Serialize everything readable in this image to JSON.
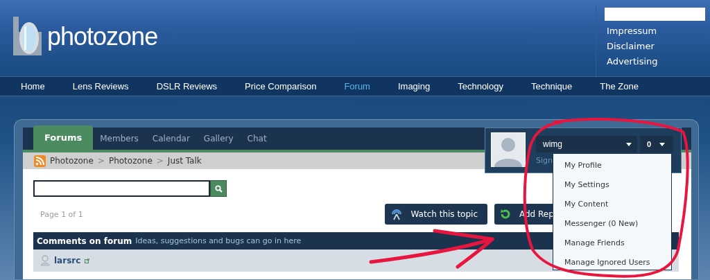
{
  "site": {
    "logo": "photozone",
    "links": [
      "Impressum",
      "Disclaimer",
      "Advertising"
    ]
  },
  "nav": [
    {
      "label": "Home",
      "selected": false
    },
    {
      "label": "Lens Reviews",
      "selected": false
    },
    {
      "label": "DSLR Reviews",
      "selected": false
    },
    {
      "label": "Price Comparison",
      "selected": false
    },
    {
      "label": "Forum",
      "selected": true
    },
    {
      "label": "Imaging",
      "selected": false
    },
    {
      "label": "Technology",
      "selected": false
    },
    {
      "label": "Technique",
      "selected": false
    },
    {
      "label": "The Zone",
      "selected": false
    }
  ],
  "tabs": [
    {
      "label": "Forums",
      "selected": true
    },
    {
      "label": "Members",
      "selected": false
    },
    {
      "label": "Calendar",
      "selected": false
    },
    {
      "label": "Gallery",
      "selected": false
    },
    {
      "label": "Chat",
      "selected": false
    }
  ],
  "breadcrumb": [
    {
      "label": "Photozone"
    },
    {
      "separator": ">",
      "label": "Photozone"
    },
    {
      "separator": ">",
      "label": "Just Talk"
    }
  ],
  "user": {
    "name": "wimg",
    "notifications": "0",
    "sign_out": "Sign"
  },
  "user_menu": [
    "My Profile",
    "My Settings",
    "My Content",
    "Messenger (0 New)",
    "Manage Friends",
    "Manage Ignored Users"
  ],
  "page_info": "Page 1 of 1",
  "actions": [
    {
      "kind": "watch",
      "label": "Watch this topic"
    },
    {
      "kind": "reply",
      "label": "Add Rep"
    }
  ],
  "topic": {
    "title": "Comments on forum",
    "description": "Ideas, suggestions and bugs can go in here"
  },
  "posts": [
    {
      "author": "larsrc"
    }
  ]
}
